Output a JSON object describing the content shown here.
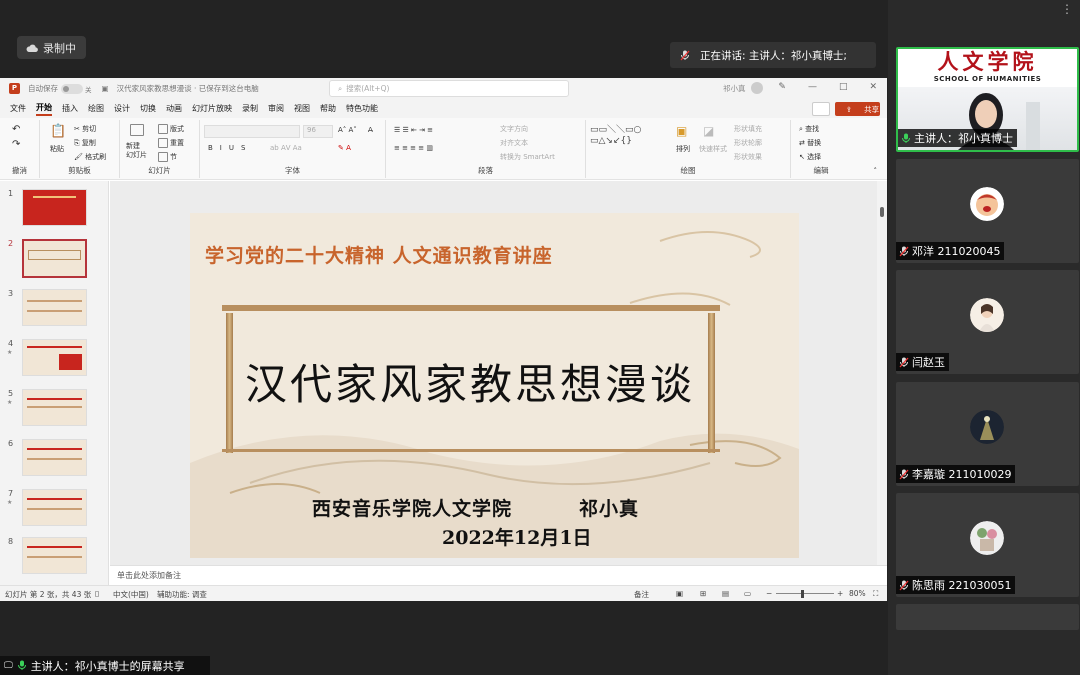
{
  "recording": {
    "label": "录制中"
  },
  "speaking": {
    "label": "正在讲话: 主讲人：祁小真博士;"
  },
  "participants": [
    {
      "name": "主讲人：祁小真博士"
    },
    {
      "name": "邓洋 211020045"
    },
    {
      "name": "闫赵玉"
    },
    {
      "name": "李嘉璇 211010029"
    },
    {
      "name": "陈思雨 221030051"
    }
  ],
  "presenter_sign": {
    "cn": "人文学院",
    "en": "SCHOOL OF HUMANITIES"
  },
  "share_bar": {
    "label": "主讲人：祁小真博士的屏幕共享"
  },
  "ppt": {
    "autosave": "自动保存",
    "autosave_state": "关",
    "doc_title": "汉代家风家教思想漫谈 · 已保存到这台电脑",
    "search_placeholder": "搜索(Alt+Q)",
    "user": "祁小真",
    "menu": [
      "文件",
      "开始",
      "插入",
      "绘图",
      "设计",
      "切换",
      "动画",
      "幻灯片放映",
      "录制",
      "审阅",
      "视图",
      "帮助",
      "特色功能"
    ],
    "active_menu": "开始",
    "share_label": "共享",
    "ribbon": {
      "undo_group": "撤消",
      "clipboard": {
        "paste": "粘贴",
        "cut": "剪切",
        "copy": "复制",
        "painter": "格式刷",
        "label": "剪贴板"
      },
      "slides": {
        "new": "新建\n幻灯片",
        "layout": "版式",
        "reset": "重置",
        "section": "节",
        "label": "幻灯片"
      },
      "font": {
        "size": "96",
        "label": "字体"
      },
      "paragraph": {
        "direction": "文字方向",
        "align": "对齐文本",
        "smartart": "转换为 SmartArt",
        "label": "段落"
      },
      "drawing": {
        "arrange": "排列",
        "styles": "快速样式",
        "fill": "形状填充",
        "outline": "形状轮廓",
        "effect": "形状效果",
        "label": "绘图"
      },
      "editing": {
        "find": "查找",
        "replace": "替换",
        "select": "选择",
        "label": "编辑"
      }
    },
    "thumb_numbers": [
      "1",
      "2",
      "3",
      "4",
      "5",
      "6",
      "7",
      "8"
    ],
    "selected_slide": 2,
    "slide": {
      "header": "学习党的二十大精神 人文通识教育讲座",
      "title": "汉代家风家教思想漫谈",
      "institution": "西安音乐学院人文学院",
      "author": "祁小真",
      "date": "2022年12月1日"
    },
    "notes_placeholder": "单击此处添加备注",
    "status": {
      "slide_count": "幻灯片 第 2 张，共 43 张",
      "language": "中文(中国)",
      "accessibility": "辅助功能: 调查",
      "notes": "备注",
      "zoom": "80%"
    }
  }
}
